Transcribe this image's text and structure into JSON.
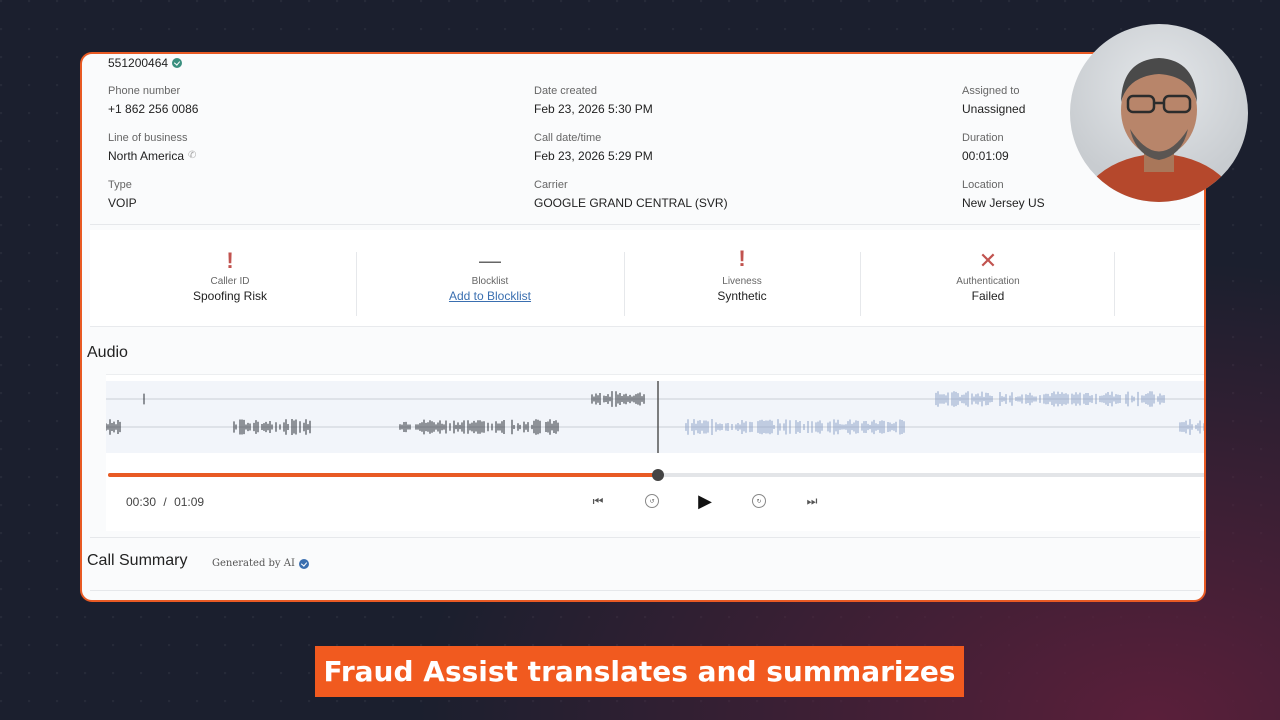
{
  "record": {
    "id": "551200464"
  },
  "details": {
    "col1": [
      {
        "label": "Phone number",
        "value": "+1 862 256 0086"
      },
      {
        "label": "Line of business",
        "value": "North America"
      },
      {
        "label": "Type",
        "value": "VOIP"
      }
    ],
    "col2": [
      {
        "label": "Date created",
        "value": "Feb 23, 2026 5:30 PM"
      },
      {
        "label": "Call date/time",
        "value": "Feb 23, 2026 5:29 PM"
      },
      {
        "label": "Carrier",
        "value": "GOOGLE GRAND CENTRAL (SVR)"
      }
    ],
    "col3": [
      {
        "label": "Assigned to",
        "value": "Unassigned"
      },
      {
        "label": "Duration",
        "value": "00:01:09"
      },
      {
        "label": "Location",
        "value": "New Jersey US"
      }
    ]
  },
  "risk": [
    {
      "icon": "!",
      "label": "Caller ID",
      "value": "Spoofing Risk"
    },
    {
      "icon": "—",
      "label": "Blocklist",
      "value": "Add to Blocklist"
    },
    {
      "icon": "!",
      "label": "Liveness",
      "value": "Synthetic"
    },
    {
      "icon": "✕",
      "label": "Authentication",
      "value": "Failed"
    }
  ],
  "audio": {
    "title": "Audio",
    "current_time": "00:30",
    "separator": "/",
    "total_time": "01:09",
    "progress": 0.5
  },
  "summary": {
    "title": "Call Summary",
    "tag": "Generated by AI"
  },
  "caption": "Fraud Assist translates and summarizes",
  "colors": {
    "accent": "#e85a24",
    "caption_bg": "#f15a1f",
    "danger": "#c1534f",
    "link": "#3a6fb0"
  }
}
